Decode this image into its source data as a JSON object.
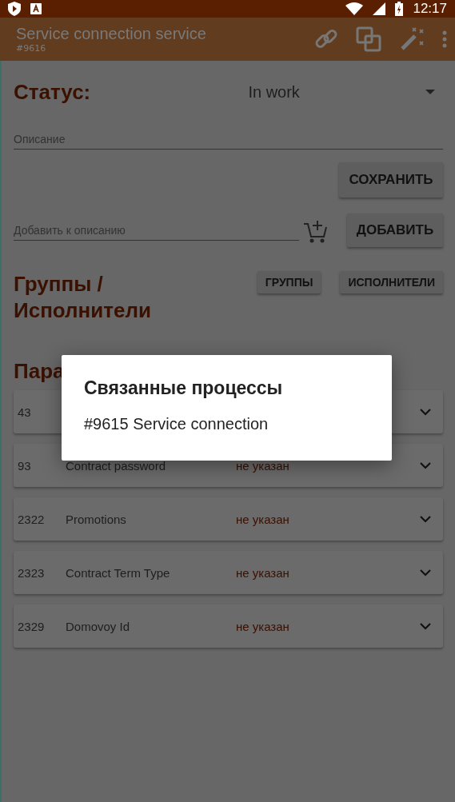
{
  "status_bar": {
    "time": "12:17"
  },
  "app_bar": {
    "title": "Service connection service",
    "subtitle": "#9616"
  },
  "status": {
    "label": "Статус:",
    "value": "In work"
  },
  "description": {
    "placeholder": "Описание"
  },
  "save_button": "СОХРАНИТЬ",
  "append": {
    "placeholder": "Добавить к описанию",
    "button": "ДОБАВИТЬ"
  },
  "groups": {
    "heading": "Группы / Исполнители",
    "buttons": [
      "ГРУППЫ",
      "ИСПОЛНИТЕЛИ"
    ]
  },
  "params": {
    "heading": "Пара",
    "rows": [
      {
        "id": "43"
      },
      {
        "id": "93",
        "name": "Contract password",
        "value": "не указан"
      },
      {
        "id": "2322",
        "name": "Promotions",
        "value": "не указан"
      },
      {
        "id": "2323",
        "name": "Contract Term Type",
        "value": "не указан"
      },
      {
        "id": "2329",
        "name": "Domovoy Id",
        "value": "не указан"
      }
    ]
  },
  "dialog": {
    "title": "Связанные процессы",
    "items": [
      "#9615 Service connection"
    ]
  }
}
